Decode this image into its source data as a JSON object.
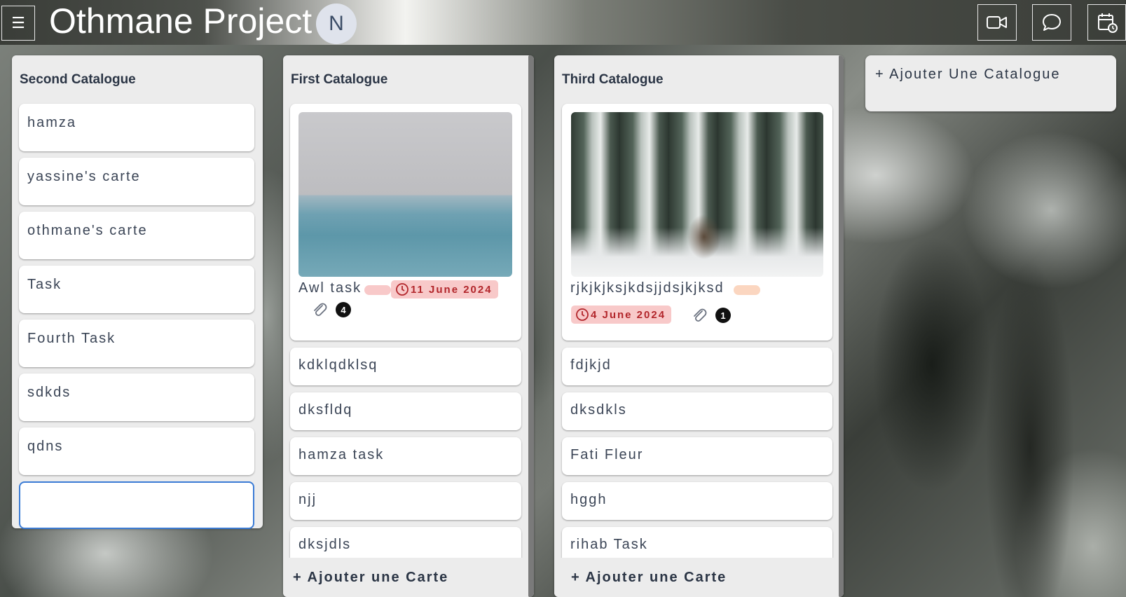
{
  "header": {
    "project_title": "Othmane Project",
    "avatar_initial": "N",
    "buttons": [
      "video-call",
      "chat",
      "calendar"
    ]
  },
  "columns": [
    {
      "title": "Second Catalogue",
      "cards": [
        "hamza",
        "yassine's carte",
        "othmane's carte",
        "Task",
        "Fourth Task",
        "sdkds",
        "qdns"
      ],
      "new_card_value": ""
    },
    {
      "title": "First Catalogue",
      "featured_card": {
        "title": "Awl task",
        "date": "11 June 2024",
        "attachments": "4",
        "label_color": "#f8c9c9"
      },
      "cards": [
        "kdklqdklsq",
        "dksfldq",
        "hamza task",
        "njj",
        "dksjdls"
      ],
      "add_card_label": "+ Ajouter une Carte"
    },
    {
      "title": "Third Catalogue",
      "featured_card": {
        "title": "rjkjkjksjkdsjjdsjkjksd",
        "date": "4 June 2024",
        "attachments": "1",
        "label_color": "#fbd6c0"
      },
      "cards": [
        "fdjkjd",
        "dksdkls",
        "Fati Fleur",
        "hggh",
        "rihab Task"
      ],
      "add_card_label": "+ Ajouter une Carte"
    }
  ],
  "add_catalogue_label": "+ Ajouter Une Catalogue",
  "colors": {
    "date_badge_bg": "#f8c9c9",
    "date_badge_text": "#b2262b",
    "input_focus": "#3a7bd5"
  }
}
